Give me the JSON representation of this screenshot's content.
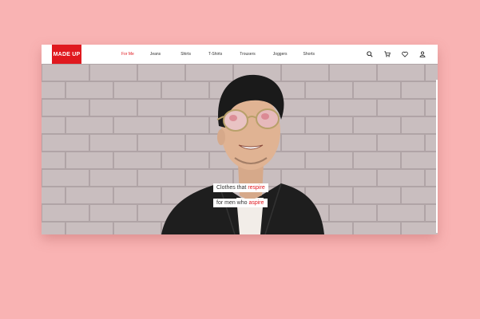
{
  "brand": {
    "logo_text": "MADE UP",
    "accent_color": "#e0191f"
  },
  "nav": {
    "links": [
      {
        "label": "For Me",
        "active": true
      },
      {
        "label": "Jeans",
        "active": false
      },
      {
        "label": "Shirts",
        "active": false
      },
      {
        "label": "T-Shirts",
        "active": false
      },
      {
        "label": "Trousers",
        "active": false
      },
      {
        "label": "Joggers",
        "active": false
      },
      {
        "label": "Shorts",
        "active": false
      }
    ],
    "icons": [
      "search-icon",
      "cart-icon",
      "heart-icon",
      "user-icon"
    ]
  },
  "hero": {
    "line1_text": "Clothes that ",
    "line1_accent": "respire",
    "line2_text": "for men who ",
    "line2_accent": "aspire"
  },
  "colors": {
    "background": "#f9b3b3",
    "wall": "#c9bebf"
  }
}
